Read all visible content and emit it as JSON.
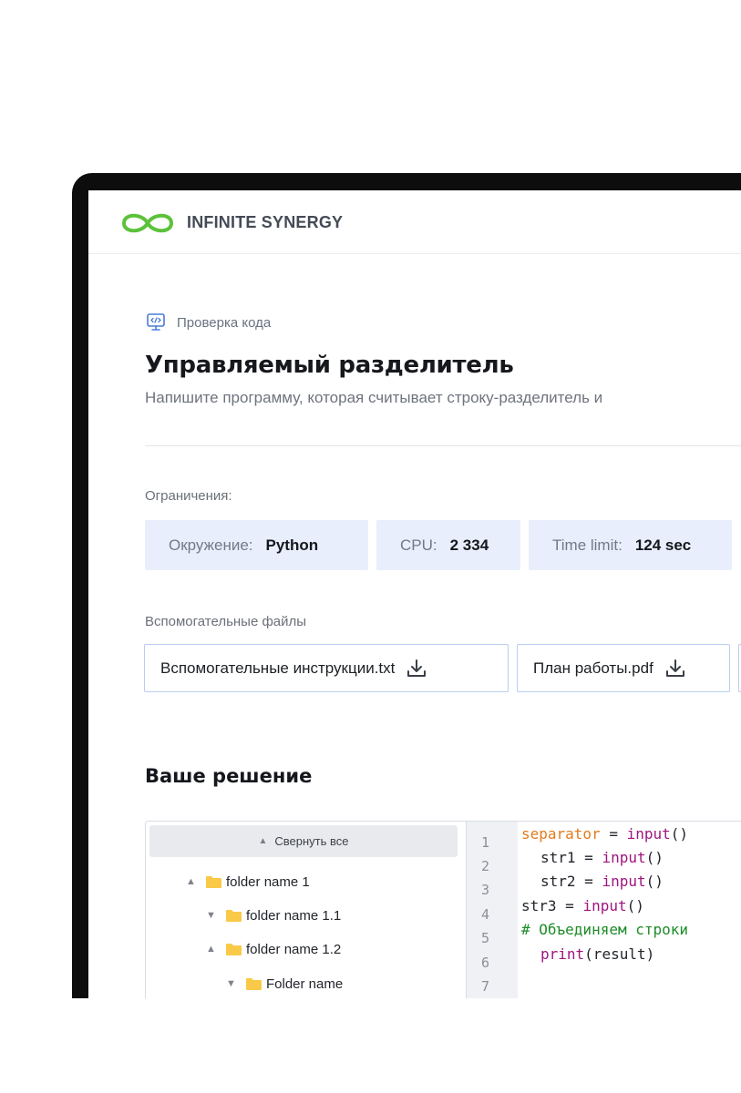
{
  "brand": {
    "name": "INFINITE SYNERGY",
    "logo_color": "#5cc23b"
  },
  "breadcrumb": {
    "icon": "code-monitor-icon",
    "label": "Проверка кода"
  },
  "task": {
    "title": "Управляемый разделитель",
    "description": "Напишите программу, которая считывает строку-разделитель и"
  },
  "limits": {
    "label": "Ограничения:",
    "items": [
      {
        "key": "Окружение:",
        "value": "Python"
      },
      {
        "key": "CPU:",
        "value": "2 334"
      },
      {
        "key": "Time limit:",
        "value": "124 sec"
      }
    ]
  },
  "files": {
    "label": "Вспомогательные файлы",
    "items": [
      {
        "name": "Вспомогательные инструкции.txt",
        "icon": "download-icon"
      },
      {
        "name": "План работы.pdf",
        "icon": "download-icon"
      }
    ]
  },
  "solution": {
    "heading": "Ваше решение",
    "tree": {
      "collapse_label": "Свернуть все",
      "nodes": [
        {
          "label": "folder name 1",
          "state": "expanded"
        },
        {
          "label": "folder name 1.1",
          "state": "collapsed"
        },
        {
          "label": "folder name 1.2",
          "state": "expanded"
        },
        {
          "label": "Folder name",
          "state": "collapsed"
        }
      ]
    },
    "line_numbers": [
      "1",
      "2",
      "3",
      "4",
      "5",
      "6",
      "7"
    ],
    "code": [
      {
        "indent": "",
        "parts": [
          [
            "orange",
            "separator"
          ],
          [
            "plain",
            " = "
          ],
          [
            "magenta",
            "input"
          ],
          [
            "plain",
            "()"
          ]
        ]
      },
      {
        "indent": "  ",
        "parts": [
          [
            "plain",
            "str1 = "
          ],
          [
            "magenta",
            "input"
          ],
          [
            "plain",
            "()"
          ]
        ]
      },
      {
        "indent": "  ",
        "parts": [
          [
            "plain",
            "str2 = "
          ],
          [
            "magenta",
            "input"
          ],
          [
            "plain",
            "()"
          ]
        ]
      },
      {
        "indent": "",
        "parts": [
          [
            "plain",
            "str3 = "
          ],
          [
            "magenta",
            "input"
          ],
          [
            "plain",
            "()"
          ]
        ]
      },
      {
        "indent": "",
        "parts": [
          [
            "green",
            "# Объединяем строки"
          ]
        ]
      },
      {
        "indent": "  ",
        "parts": [
          [
            "magenta",
            "print"
          ],
          [
            "plain",
            "(result)"
          ]
        ]
      }
    ]
  }
}
